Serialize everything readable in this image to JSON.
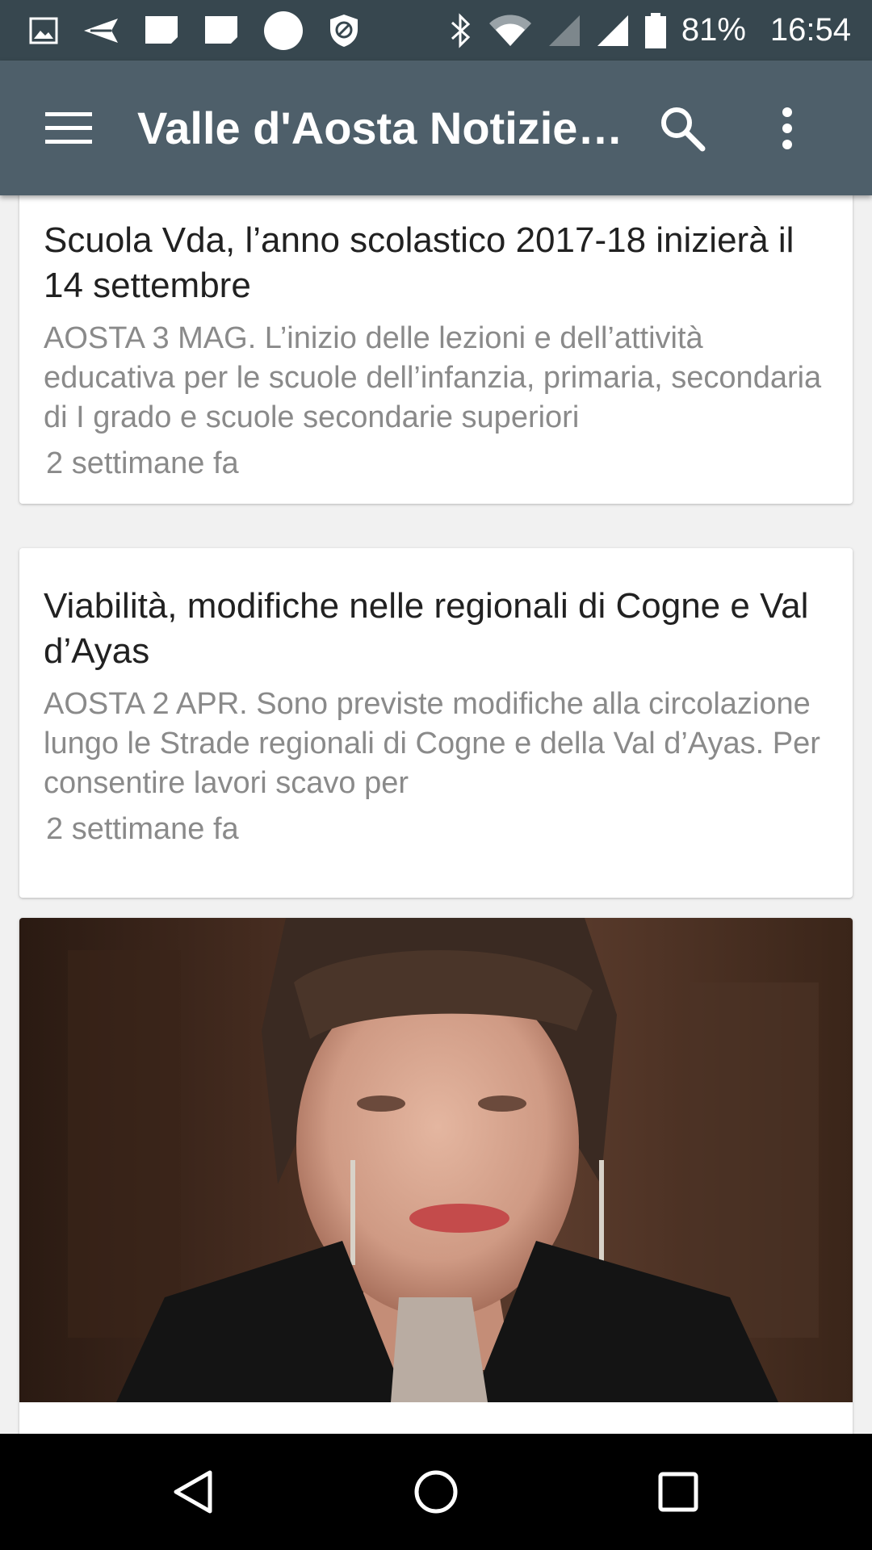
{
  "status_bar": {
    "icons": [
      "image-icon",
      "send-icon",
      "notification-icon",
      "notification-icon",
      "circle-icon",
      "block-icon",
      "bluetooth-icon",
      "wifi-icon",
      "signal-icon",
      "signal-icon",
      "battery-icon"
    ],
    "battery": "81%",
    "time": "16:54"
  },
  "app_bar": {
    "title": "Valle d'Aosta Notizie…",
    "icons": [
      "menu-icon",
      "search-icon",
      "more-vert-icon"
    ]
  },
  "articles": [
    {
      "title": "Scuola Vda, l’anno scolastico 2017-18 inizierà il 14 settembre",
      "summary": "AOSTA 3 MAG. L’inizio delle lezioni e dell’attività educativa per le scuole dell’infanzia, primaria, secondaria di I grado e scuole secondarie superiori",
      "time": "2 settimane fa"
    },
    {
      "title": "Viabilità, modifiche nelle regionali di Cogne e Val d’Ayas",
      "summary": "AOSTA 2 APR.  Sono previste modifiche alla circolazione lungo le Strade regionali di Cogne e della Val d’Ayas. Per consentire lavori scavo per",
      "time": "2 settimane fa"
    }
  ],
  "nav_bar": {
    "icons": [
      "back-icon",
      "home-icon",
      "recents-icon"
    ]
  },
  "colors": {
    "status_bar": "#37474f",
    "app_bar": "#4e5f6a",
    "background": "#f1f1f1",
    "title_text": "#212121",
    "secondary_text": "#8a8a8a"
  }
}
